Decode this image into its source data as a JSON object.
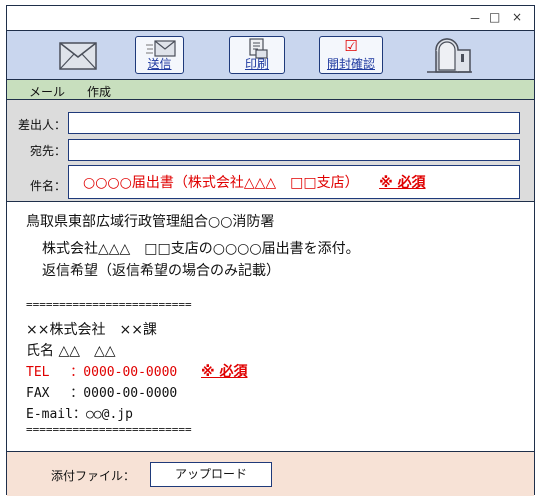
{
  "window": {
    "minimize": "－",
    "maximize": "□",
    "close": "×"
  },
  "toolbar": {
    "send_label": "送信",
    "print_label": "印刷",
    "open_confirm_label": "開封確認",
    "open_confirm_check": "☑"
  },
  "menu": {
    "items": [
      "メール",
      "作成"
    ]
  },
  "fields": {
    "sender_label": "差出人：",
    "sender_value": "",
    "to_label": "宛先：",
    "to_value": "",
    "subject_label": "件名：",
    "subject_value": "○○○○届出書（株式会社△△△　□□支店）",
    "subject_required": "※ 必須"
  },
  "body": {
    "recipient": "鳥取県東部広域行政管理組合○○消防署",
    "line1": "株式会社△△△　□□支店の○○○○届出書を添付。",
    "line2": "返信希望（返信希望の場合のみ記載）",
    "separator": "=========================",
    "company": "××株式会社　××課",
    "name_line": "氏名 △△　△△",
    "tel_line": "TEL　 ：0000-00-0000",
    "tel_required": "※ 必須",
    "fax_line": "FAX　 ：0000-00-0000",
    "email_line": "E-mail：○○@.jp"
  },
  "footer": {
    "attachment_label": "添付ファイル：",
    "upload_button": "アップロード"
  },
  "colors": {
    "toolbar_bg": "#c9d6ee",
    "menubar_bg": "#c8dfbe",
    "header_bg": "#dcdcdc",
    "footer_bg": "#f7e2d6",
    "required_red": "#e00000",
    "border_navy": "#1f2f4a"
  }
}
